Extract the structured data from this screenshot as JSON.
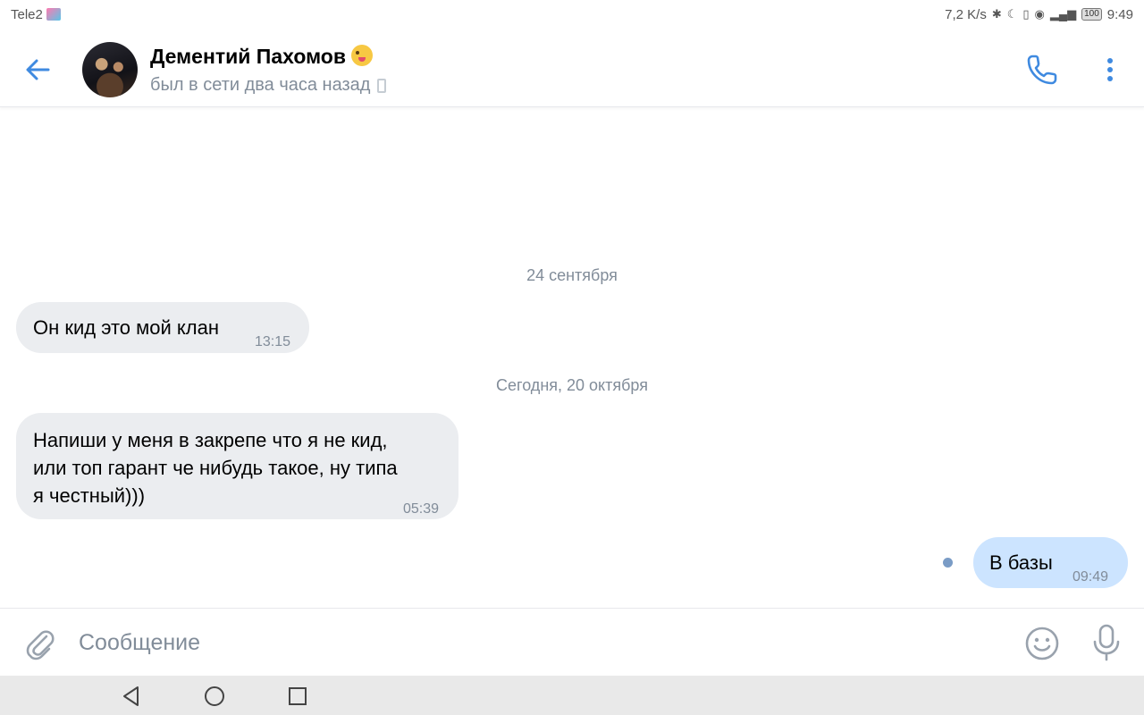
{
  "statusbar": {
    "carrier": "Tele2",
    "speed": "7,2 K/s",
    "battery": "100",
    "time": "9:49"
  },
  "header": {
    "name": "Дементий Пахомов",
    "status": "был в сети два часа назад"
  },
  "messages": {
    "date1": "24 сентября",
    "msg1_text": "Он кид это мой клан",
    "msg1_time": "13:15",
    "date2": "Сегодня, 20 октября",
    "msg2_line1": "Напиши у меня в закрепе что я не кид,",
    "msg2_line2": "или топ гарант че нибудь такое, ну типа",
    "msg2_line3": "я честный)))",
    "msg2_time": "05:39",
    "msg3_text": "В базы",
    "msg3_time": "09:49"
  },
  "composer": {
    "placeholder": "Сообщение"
  },
  "colors": {
    "accent": "#3f8ae0",
    "incoming_bubble": "#ebedf0",
    "outgoing_bubble": "#cce4ff",
    "secondary_text": "#818c99"
  },
  "icons": {
    "back": "arrow-left-icon",
    "call": "phone-icon",
    "more": "more-vertical-icon",
    "attach": "paperclip-icon",
    "emoji": "smile-icon",
    "mic": "microphone-icon"
  }
}
